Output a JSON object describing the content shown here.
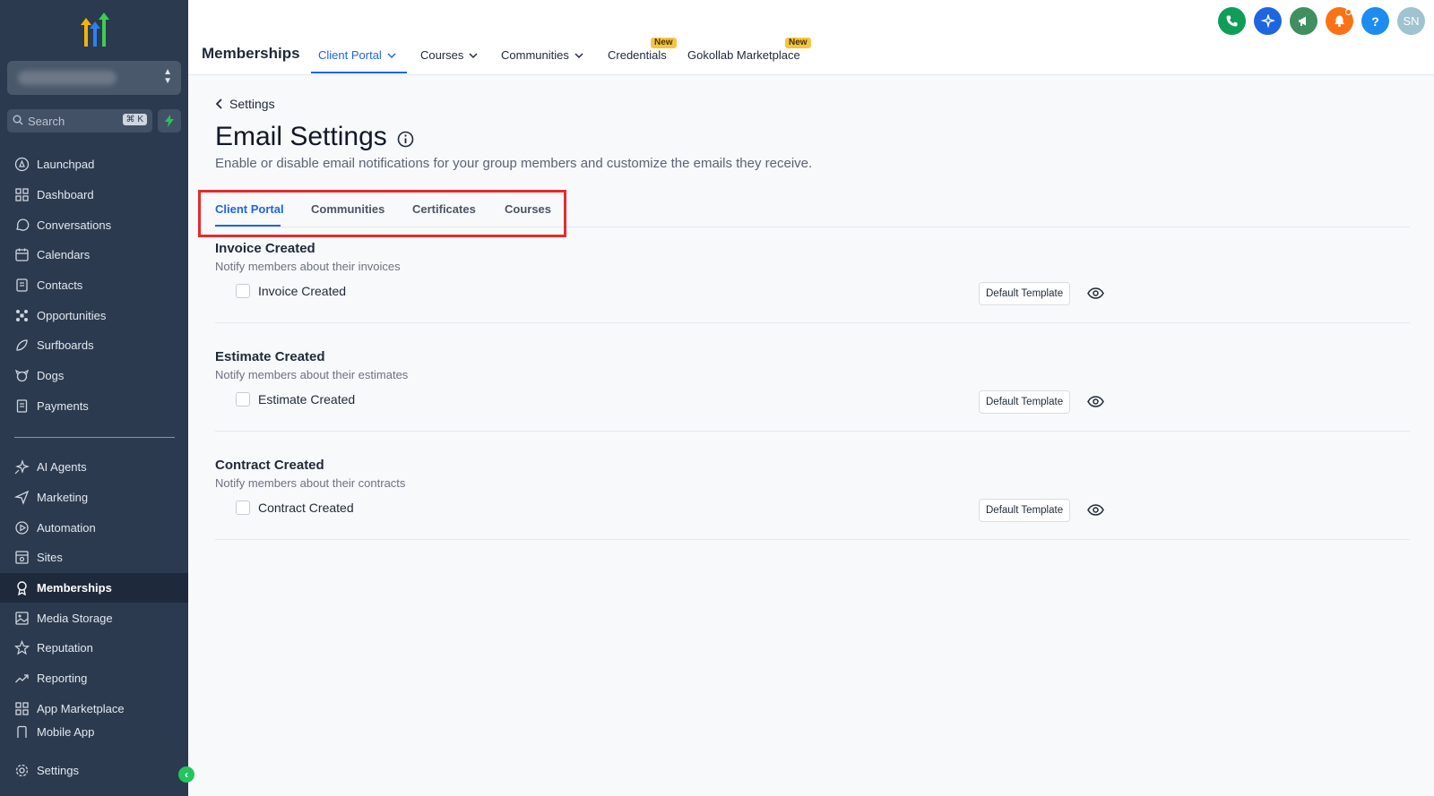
{
  "sidebar": {
    "search": {
      "label": "Search",
      "shortcut": "⌘ K"
    },
    "items": [
      {
        "label": "Launchpad",
        "icon": "rocket-icon"
      },
      {
        "label": "Dashboard",
        "icon": "grid-icon"
      },
      {
        "label": "Conversations",
        "icon": "chat-icon"
      },
      {
        "label": "Calendars",
        "icon": "calendar-icon"
      },
      {
        "label": "Contacts",
        "icon": "contacts-icon"
      },
      {
        "label": "Opportunities",
        "icon": "opportunities-icon"
      },
      {
        "label": "Surfboards",
        "icon": "surfboard-icon"
      },
      {
        "label": "Dogs",
        "icon": "dog-icon"
      },
      {
        "label": "Payments",
        "icon": "payments-icon"
      }
    ],
    "items2": [
      {
        "label": "AI Agents",
        "icon": "sparkle-icon"
      },
      {
        "label": "Marketing",
        "icon": "send-icon"
      },
      {
        "label": "Automation",
        "icon": "automation-icon"
      },
      {
        "label": "Sites",
        "icon": "sites-icon"
      },
      {
        "label": "Memberships",
        "icon": "membership-icon"
      },
      {
        "label": "Media Storage",
        "icon": "image-icon"
      },
      {
        "label": "Reputation",
        "icon": "star-icon"
      },
      {
        "label": "Reporting",
        "icon": "trend-icon"
      },
      {
        "label": "App Marketplace",
        "icon": "apps-icon"
      },
      {
        "label": "Mobile App",
        "icon": "mobile-icon"
      }
    ],
    "settings": "Settings",
    "active": "Memberships"
  },
  "topbar": {
    "title": "Memberships",
    "nav": [
      {
        "label": "Client Portal"
      },
      {
        "label": "Courses"
      },
      {
        "label": "Communities"
      },
      {
        "label": "Credentials",
        "badge": "New"
      },
      {
        "label": "Gokollab Marketplace",
        "badge": "New"
      }
    ],
    "avatar": "SN",
    "help": "?"
  },
  "page": {
    "back_label": "Settings",
    "title": "Email Settings",
    "description": "Enable or disable email notifications for your group members and customize the emails they receive.",
    "tabs": [
      "Client Portal",
      "Communities",
      "Certificates",
      "Courses"
    ],
    "active_tab": "Client Portal",
    "sections": [
      {
        "title": "Invoice Created",
        "description": "Notify members about their invoices",
        "checkbox_label": "Invoice Created",
        "checked": false,
        "button": "Default Template"
      },
      {
        "title": "Estimate Created",
        "description": "Notify members about their estimates",
        "checkbox_label": "Estimate Created",
        "checked": false,
        "button": "Default Template"
      },
      {
        "title": "Contract Created",
        "description": "Notify members about their contracts",
        "checkbox_label": "Contract Created",
        "checked": false,
        "button": "Default Template"
      }
    ]
  },
  "colors": {
    "sidebar_bg": "#2b3a4f",
    "accent": "#1d66e0",
    "highlight": "#e52b2b"
  }
}
